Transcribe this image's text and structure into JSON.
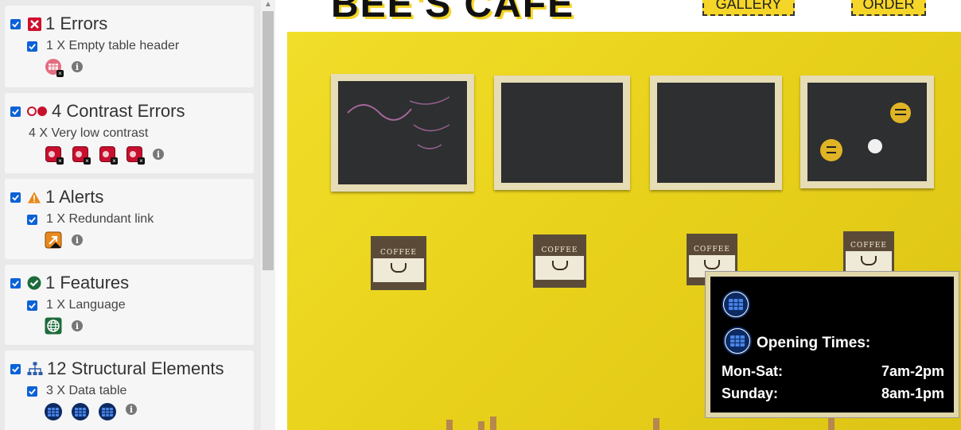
{
  "sidebar": {
    "errors": {
      "title": "1 Errors",
      "item_label": "1 X Empty table header"
    },
    "contrast": {
      "title": "4 Contrast Errors",
      "item_label": "4 X Very low contrast"
    },
    "alerts": {
      "title": "1 Alerts",
      "item_label": "1 X Redundant link"
    },
    "features": {
      "title": "1 Features",
      "item_label": "1 X Language"
    },
    "structural": {
      "title": "12 Structural Elements",
      "item_label": "3 X Data table"
    },
    "info_glyph": "i"
  },
  "site": {
    "logo_text": "BEE'S CAFE",
    "nav": {
      "gallery": "GALLERY",
      "order": "ORDER"
    },
    "posters": [
      {
        "title": "COFFEE"
      },
      {
        "title": "COFFEE"
      },
      {
        "title": "COFFEE"
      },
      {
        "title": "COFFEE"
      }
    ],
    "hours": {
      "title": "Opening Times:",
      "rows": [
        {
          "day": "Mon-Sat:",
          "time": "7am-2pm"
        },
        {
          "day": "Sunday:",
          "time": "8am-1pm"
        }
      ]
    }
  },
  "colors": {
    "accent_yellow": "#f4d528",
    "error_red": "#c8102e",
    "checkbox_blue": "#0b62d6",
    "table_icon_navy": "#0c2a63",
    "feature_green": "#1e6b3c"
  }
}
